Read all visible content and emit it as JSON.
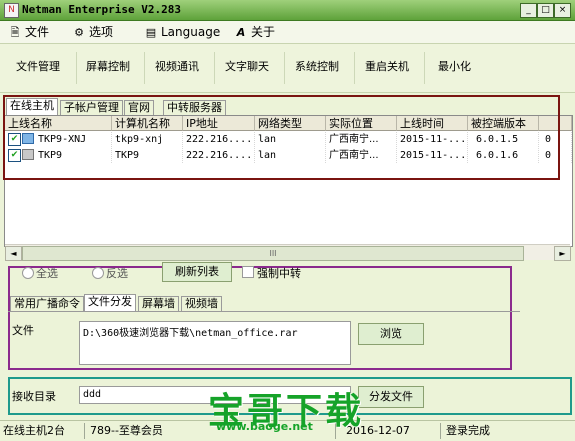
{
  "window": {
    "title": "Netman Enterprise V2.283",
    "controls": [
      "_",
      "□",
      "×"
    ]
  },
  "menu": [
    {
      "label": "文件",
      "icon": "document-icon"
    },
    {
      "label": "选项",
      "icon": "options-icon"
    },
    {
      "label": "Language",
      "icon": "language-icon"
    },
    {
      "label": "关于",
      "icon": "about-icon"
    }
  ],
  "toolbar": {
    "file_manage": "文件管理",
    "screen_control": "屏幕控制",
    "video_comm": "视频通讯",
    "text_chat": "文字聊天",
    "system_control": "系统控制",
    "restart_shutdown": "重启关机",
    "minimize": "最小化"
  },
  "top_tabs": {
    "online_hosts": "在线主机",
    "sub_accounts": "子帐户管理",
    "official_site": "官网",
    "relay_server": "中转服务器"
  },
  "grid": {
    "headers": [
      "上线名称",
      "计算机名称",
      "IP地址",
      "网络类型",
      "实际位置",
      "上线时间",
      "被控端版本",
      ""
    ],
    "rows": [
      {
        "checked": true,
        "name": "TKP9-XNJ",
        "computer": "tkp9-xnj",
        "ip": "222.216....",
        "net": "lan",
        "location": "广西南宁...",
        "time": "2015-11-...",
        "version": "6.0.1.5",
        "extra": "0"
      },
      {
        "checked": true,
        "name": "TKP9",
        "computer": "TKP9",
        "ip": "222.216....",
        "net": "lan",
        "location": "广西南宁...",
        "time": "2015-11-...",
        "version": "6.0.1.6",
        "extra": "0"
      }
    ]
  },
  "scrollbar": {
    "left_arrow": "◄",
    "right_arrow": "►",
    "thumb_grip": "III"
  },
  "controls_row": {
    "select_all": "全选",
    "invert": "反选",
    "refresh": "刷新列表",
    "force_relay": "强制中转"
  },
  "bottom_tabs": {
    "broadcast": "常用广播命令",
    "file_dist": "文件分发",
    "screen_wall": "屏幕墙",
    "video_wall": "视频墙"
  },
  "file_panel": {
    "file_label": "文件",
    "file_path": "D:\\360极速浏览器下载\\netman_office.rar",
    "browse": "浏览",
    "receive_label": "接收目录",
    "receive_value": "ddd",
    "send_button": "分发文件"
  },
  "status": {
    "online_count": "在线主机2台",
    "account": "789--至尊会员",
    "date": "2016-12-07",
    "login": "登录完成"
  },
  "watermark": {
    "big": "宝哥下载",
    "url": "www.baoge.net"
  },
  "colors": {
    "frame_red": "#7a1410",
    "frame_purple": "#8b2a8d",
    "frame_teal": "#1f9a8c",
    "watermark_green": "#16a329"
  }
}
